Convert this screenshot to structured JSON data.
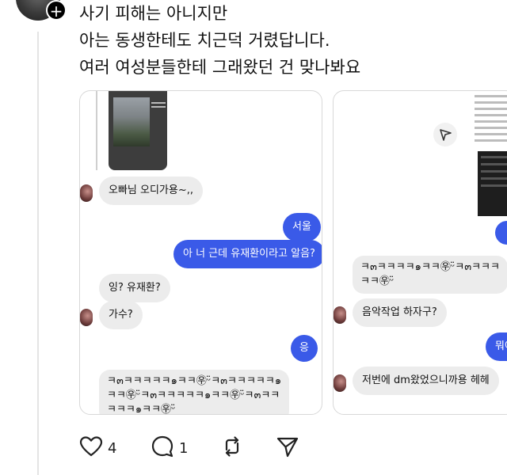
{
  "post": {
    "lines": [
      "사기 피해는 아니지만",
      "아는 동생한테도 치근덕 거렸답니다.",
      "여러 여성분들한테 그래왔던 건 맞나봐요"
    ]
  },
  "left_screenshot": {
    "messages": [
      {
        "side": "in",
        "text": "오빠님 오디가용~,,"
      },
      {
        "side": "out",
        "text": "서울"
      },
      {
        "side": "out",
        "text": "아 너 근데 유재환이라고 알음?"
      },
      {
        "side": "in",
        "text": "잉? 유재환?"
      },
      {
        "side": "in",
        "text": "가수?"
      },
      {
        "side": "out",
        "text": "응"
      },
      {
        "side": "in",
        "text": "ㅋ๓ㅋㅋㅋㅋㅋ๑ㅋㅋ㉾ᵕ̈ㅋ๓ㅋㅋㅋㅋㅋ๑"
      },
      {
        "side": "in",
        "text": "ㅋㅋ㉾ᵕ̈ㅋ๓ㅋㅋㅋㅋㅋ๑ㅋㅋ㉾ᵕ̈ㅋ๓ㅋㅋ"
      },
      {
        "side": "in",
        "text": "ㅋㅋㅋ๑ㅋㅋ㉾ᵕ̈"
      }
    ]
  },
  "right_screenshot": {
    "messages": [
      {
        "side": "in",
        "text": "ㅋ๓ㅋㅋㅋㅋ๑ㅋㅋ㉾ᵕ̈ㅋ๓ㅋㅋㅋ"
      },
      {
        "side": "in",
        "text": "ㅋㅋ㉾ᵕ̈"
      },
      {
        "side": "in",
        "text": "음악작업 하자구?"
      },
      {
        "side": "out",
        "text": "뭐여"
      },
      {
        "side": "in",
        "text": "저번에 dm왔었으니까용 헤헤"
      }
    ]
  },
  "actions": {
    "like_count": "4",
    "comment_count": "1"
  },
  "icons": [
    "heart-icon",
    "comment-icon",
    "repost-icon",
    "send-icon",
    "plus-icon"
  ],
  "colors": {
    "accent": "#3a5ae8",
    "bubble_in": "#ececec"
  }
}
